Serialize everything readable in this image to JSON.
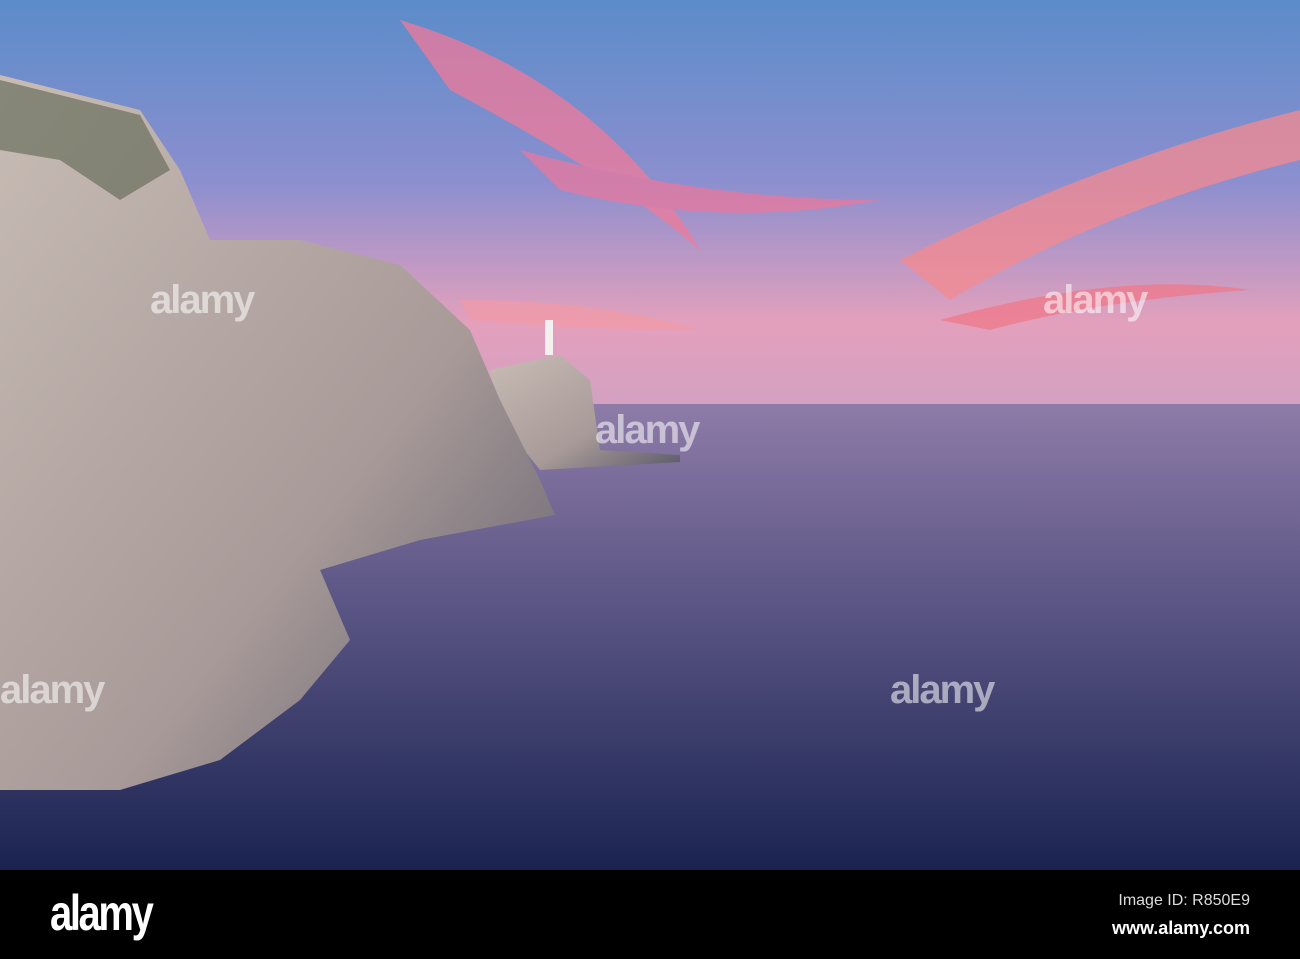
{
  "photo": {
    "subject": "Lighthouse on sea cliffs at sunset",
    "colors": {
      "sky_top": "#5b8cc9",
      "sky_pink": "#f08aa0",
      "horizon": "#e8a4b8",
      "sea_top": "#8a7aa6",
      "sea_bottom": "#1c2550",
      "cliff": "#b8aca6"
    }
  },
  "watermark": {
    "text": "alamy"
  },
  "footer": {
    "logo": "alamy",
    "image_id": "Image ID: R850E9",
    "url": "www.alamy.com"
  }
}
